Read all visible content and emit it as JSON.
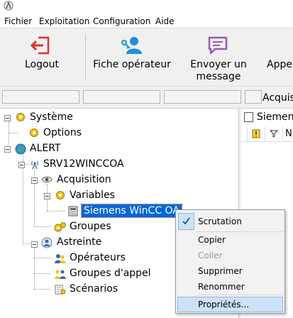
{
  "menubar": {
    "items": [
      "Fichier",
      "Exploitation",
      "Configuration",
      "Aide"
    ]
  },
  "toolbar": {
    "logout_label": "Logout",
    "fiche_label": "Fiche opérateur",
    "envoyer_line1": "Envoyer un",
    "envoyer_line2": "message",
    "appel_label": "Appel"
  },
  "statusbar": {
    "acquisition_label": "Acquis"
  },
  "tree": {
    "systeme": "Système",
    "options": "Options",
    "alert": "ALERT",
    "server": "SRV12WINCCOA",
    "acquisition": "Acquisition",
    "variables": "Variables",
    "siemens": "Siemens WinCC OA",
    "groupes": "Groupes",
    "astreinte": "Astreinte",
    "operateurs": "Opérateurs",
    "groupes_appel": "Groupes d'appel",
    "scenarios": "Scénarios"
  },
  "right_pane": {
    "title": "Siemen",
    "col_last": "N"
  },
  "context_menu": {
    "scrutation": "Scrutation",
    "copier": "Copier",
    "coller": "Coller",
    "supprimer": "Supprimer",
    "renommer": "Renommer",
    "proprietes": "Propriétés..."
  },
  "colors": {
    "selection": "#0a66d6",
    "menu_highlight": "#cde2f6",
    "logout_red": "#d9342b",
    "user_blue": "#1f8fd6",
    "message_purple": "#9b59b6"
  }
}
